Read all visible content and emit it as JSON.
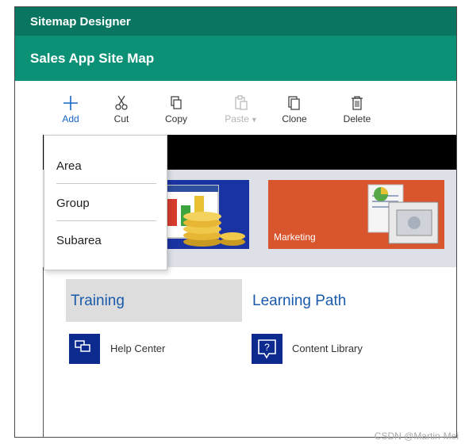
{
  "window": {
    "title": "Sitemap Designer"
  },
  "sitemap": {
    "title": "Sales App Site Map"
  },
  "toolbar": {
    "add": {
      "label": "Add",
      "icon": "plus-icon"
    },
    "cut": {
      "label": "Cut",
      "icon": "scissors-icon"
    },
    "copy": {
      "label": "Copy",
      "icon": "copy-icon"
    },
    "paste": {
      "label": "Paste",
      "icon": "paste-icon",
      "disabled": true
    },
    "clone": {
      "label": "Clone",
      "icon": "clone-icon"
    },
    "delete": {
      "label": "Delete",
      "icon": "trash-icon"
    }
  },
  "add_menu": {
    "items": [
      "Area",
      "Group",
      "Subarea"
    ]
  },
  "tiles": [
    {
      "label": "",
      "color": "#1a33a3"
    },
    {
      "label": "Marketing",
      "color": "#d9552d"
    }
  ],
  "groups": [
    {
      "title": "Training",
      "selected": true,
      "subareas": [
        {
          "label": "Help Center",
          "icon": "help-center-icon"
        }
      ]
    },
    {
      "title": "Learning Path",
      "selected": false,
      "subareas": [
        {
          "label": "Content Library",
          "icon": "question-bubble-icon"
        }
      ]
    }
  ],
  "colors": {
    "title_bar": "#0a7560",
    "sub_bar": "#0d9176",
    "accent": "#1666c5",
    "heading": "#1a5aab"
  },
  "watermark": "CSDN @Martin-Mei"
}
